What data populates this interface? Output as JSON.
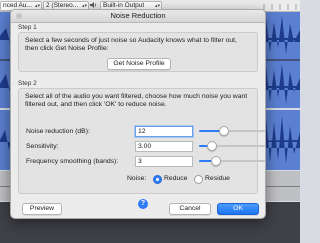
{
  "toolbar": {
    "host_select": "nced Au...",
    "channels_select": "2 (Stereo...",
    "output_select": "Built-in Output"
  },
  "dialog": {
    "title": "Noise Reduction",
    "step1": {
      "label": "Step 1",
      "line1": "Select a few seconds of just noise so Audacity knows what to filter out,",
      "line2": "then click Get Noise Profile:",
      "button": "Get Noise Profile"
    },
    "step2": {
      "label": "Step 2",
      "line1": "Select all of the audio you want filtered, choose how much noise you want",
      "line2": "filtered out, and then click 'OK' to reduce noise.",
      "noise_reduction": {
        "label": "Noise reduction (dB):",
        "value": "12",
        "slider_level": 0.35
      },
      "sensitivity": {
        "label": "Sensitivity:",
        "value": "3.00",
        "slider_level": 0.14
      },
      "frequency_smoothing": {
        "label": "Frequency smoothing (bands):",
        "value": "3",
        "slider_level": 0.2
      },
      "noise_label": "Noise:",
      "reduce_label": "Reduce",
      "residue_label": "Residue",
      "selected_mode": "Reduce"
    },
    "buttons": {
      "preview": "Preview",
      "help": "?",
      "cancel": "Cancel",
      "ok": "OK"
    }
  },
  "colors": {
    "accent": "#2d7cf6",
    "waveform_track": "#5b7fd1",
    "waveform": "#1e3c8c"
  }
}
